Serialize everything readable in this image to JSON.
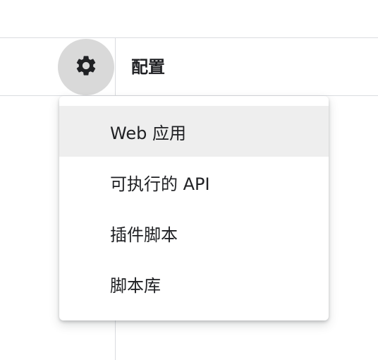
{
  "header": {
    "title": "配置",
    "settings_icon": "gear-icon"
  },
  "menu": {
    "items": [
      {
        "label": "Web 应用",
        "highlighted": true
      },
      {
        "label": "可执行的 API",
        "highlighted": false
      },
      {
        "label": "插件脚本",
        "highlighted": false
      },
      {
        "label": "脚本库",
        "highlighted": false
      }
    ]
  },
  "colors": {
    "gear_button_bg": "#d9d9d9",
    "highlight_bg": "#eeeeee",
    "divider": "#dadce0",
    "text": "#202124"
  }
}
